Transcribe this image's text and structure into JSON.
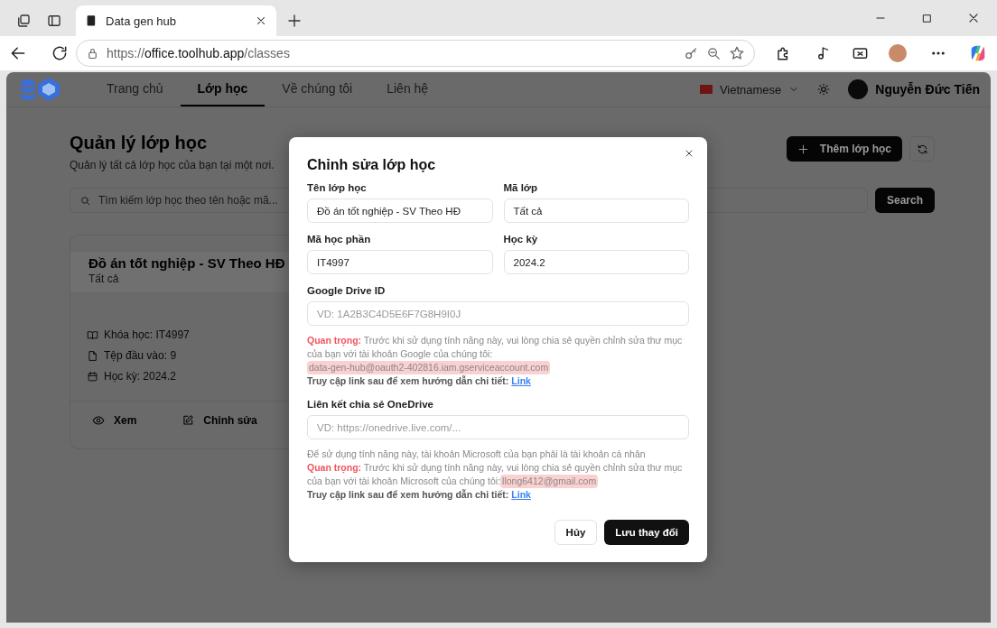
{
  "browser": {
    "tab": {
      "title": "Data gen hub"
    },
    "address": {
      "scheme": "https://",
      "host": "office.toolhub.app",
      "path": "/classes"
    }
  },
  "nav": {
    "items": [
      {
        "label": "Trang chủ",
        "selected": false
      },
      {
        "label": "Lớp học",
        "selected": true
      },
      {
        "label": "Về chúng tôi",
        "selected": false
      },
      {
        "label": "Liên hệ",
        "selected": false
      }
    ],
    "language": "Vietnamese",
    "user": "Nguyễn Đức Tiến"
  },
  "page": {
    "title": "Quản lý lớp học",
    "subtitle": "Quản lý tất cả lớp học của bạn tại một nơi.",
    "add_button": "Thêm lớp học",
    "search": {
      "placeholder": "Tìm kiếm lớp học theo tên hoặc mã..."
    },
    "search_button": "Search",
    "card": {
      "title": "Đồ án tốt nghiệp - SV Theo HĐ",
      "subtitle": "Tất cả",
      "details": [
        {
          "kind": "book",
          "text": "Khóa học: IT4997"
        },
        {
          "kind": "file",
          "text": "Tệp đầu vào: 9"
        },
        {
          "kind": "calendar",
          "text": "Học kỳ: 2024.2"
        }
      ],
      "actions": [
        {
          "kind": "view",
          "label": "Xem"
        },
        {
          "kind": "edit",
          "label": "Chỉnh sửa"
        }
      ]
    }
  },
  "dialog": {
    "title": "Chỉnh sửa lớp học",
    "fields": [
      {
        "label": "Tên lớp học",
        "value": "Đồ án tốt nghiệp - SV Theo HĐ",
        "wide": false
      },
      {
        "label": "Mã lớp",
        "value": "Tất cả",
        "wide": false
      },
      {
        "label": "Mã học phần",
        "value": "IT4997",
        "wide": false
      },
      {
        "label": "Học kỳ",
        "value": "2024.2",
        "wide": false
      },
      {
        "label": "Google Drive ID",
        "placeholder": "VD: 1A2B3C4D5E6F7G8H9I0J",
        "wide": true,
        "notes": [
          {
            "kind": "important",
            "text": "**Quan trọng:** Trước khi sử dụng tính năng này, vui lòng chia sẻ quyền chỉnh sửa thư mục của bạn với tài khoản Google của chúng tôi:",
            "email": "data-gen-hub@oauth2-402816.iam.gserviceaccount.com"
          },
          {
            "kind": "guide",
            "text": "Truy cập link sau để xem hướng dẫn chi tiết:",
            "link": "Link"
          }
        ]
      },
      {
        "label": "Liên kết chia sẻ OneDrive",
        "placeholder": "VD: https://onedrive.live.com/...",
        "wide": true,
        "notes": [
          {
            "kind": "plain",
            "text": "Để sử dụng tính năng này, tài khoản Microsoft của bạn phải là tài khoản cá nhân"
          },
          {
            "kind": "important",
            "text": "**Quan trọng:** Trước khi sử dụng tính năng này, vui lòng chia sẻ quyền chỉnh sửa thư mục của bạn với tài khoản Microsoft của chúng tôi:",
            "email": "llong6412@gmail.com"
          },
          {
            "kind": "guide",
            "text": "Truy cập link sau để xem hướng dẫn chi tiết:",
            "link": "Link"
          }
        ]
      }
    ],
    "cancel_button": "Hủy",
    "save_button": "Lưu thay đổi"
  }
}
